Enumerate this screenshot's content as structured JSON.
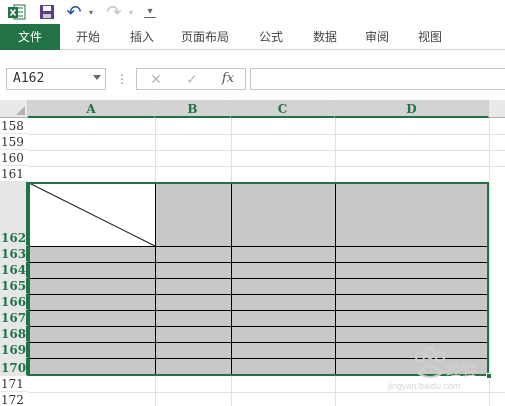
{
  "qat": {
    "undo_label": "↶",
    "redo_label": "↷",
    "more_label": "▾"
  },
  "ribbon": {
    "tabs": [
      {
        "label": "文件",
        "active": true
      },
      {
        "label": "开始"
      },
      {
        "label": "插入"
      },
      {
        "label": "页面布局"
      },
      {
        "label": "公式"
      },
      {
        "label": "数据"
      },
      {
        "label": "审阅"
      },
      {
        "label": "视图"
      }
    ]
  },
  "formula_bar": {
    "name_box": "A162",
    "separator": "⋮",
    "cancel": "✕",
    "enter": "✓",
    "fx": "fx",
    "value": ""
  },
  "sheet": {
    "columns": [
      "A",
      "B",
      "C",
      "D"
    ],
    "rows": [
      "158",
      "159",
      "160",
      "161",
      "162",
      "163",
      "164",
      "165",
      "166",
      "167",
      "168",
      "169",
      "170",
      "171",
      "172"
    ],
    "selected_range": "A162:D170"
  },
  "watermark": {
    "text": "经验",
    "subtext": "jingyan.baidu.com"
  },
  "colors": {
    "accent": "#217346",
    "cell_fill": "#c8c8c8"
  }
}
